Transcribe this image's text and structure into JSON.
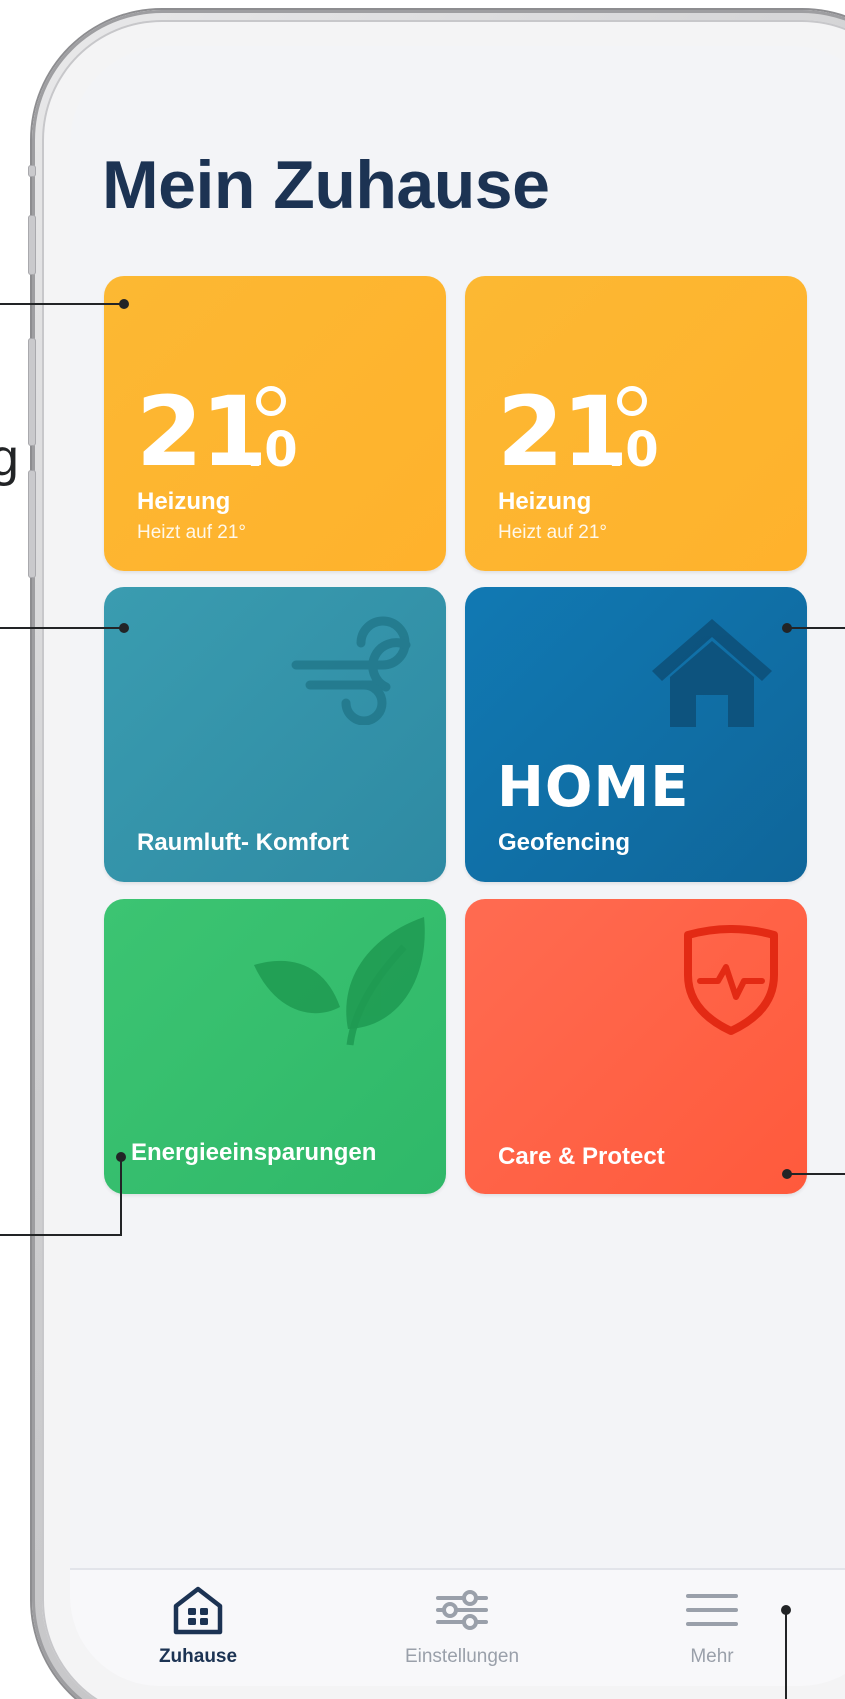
{
  "page": {
    "title": "Mein Zuhause"
  },
  "tiles": {
    "heating_1": {
      "temp_integer": "21",
      "temp_decimal": ".0",
      "label": "Heizung",
      "status": "Heizt auf 21°"
    },
    "heating_2": {
      "temp_integer": "21",
      "temp_decimal": ".0",
      "label": "Heizung",
      "status": "Heizt auf 21°"
    },
    "air": {
      "label": "Raumluft- Komfort",
      "icon": "wind-icon"
    },
    "geofencing": {
      "mode": "HOME",
      "label": "Geofencing",
      "icon": "house-icon"
    },
    "energy": {
      "label": "Energieeinsparungen",
      "icon": "leaf-icon"
    },
    "care": {
      "label": "Care & Protect",
      "icon": "shield-heartbeat-icon"
    }
  },
  "tabbar": {
    "tabs": [
      {
        "label": "Zuhause",
        "icon": "home-grid-icon",
        "active": true
      },
      {
        "label": "Einstellungen",
        "icon": "sliders-icon",
        "active": false
      },
      {
        "label": "Mehr",
        "icon": "menu-icon",
        "active": false
      }
    ]
  },
  "annotations": {
    "cropped_glyph": "g"
  },
  "colors": {
    "title": "#1c3353",
    "heating": "#ffb22c",
    "air": "#3399ad",
    "geofencing": "#1172ab",
    "energy": "#36bf6e",
    "care": "#ff6048",
    "tab_active": "#1c3353",
    "tab_inactive": "#9aa0aa"
  }
}
